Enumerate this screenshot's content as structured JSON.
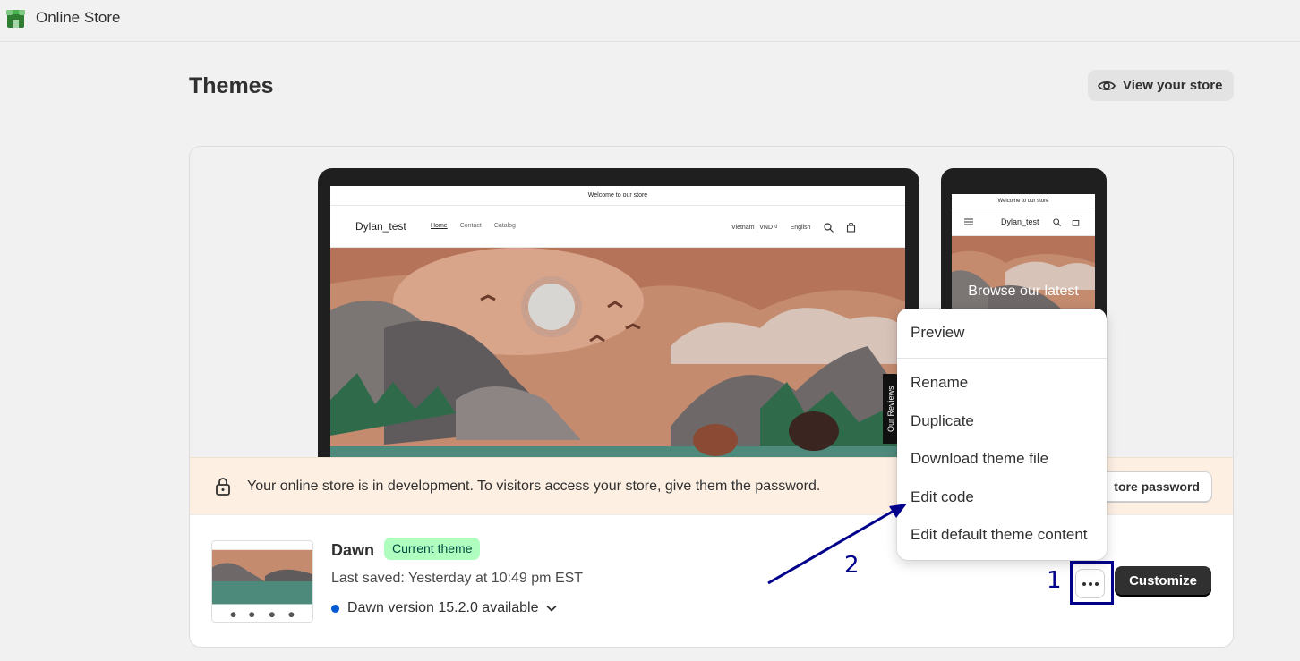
{
  "topbar": {
    "app_title": "Online Store"
  },
  "page": {
    "title": "Themes",
    "view_store_label": "View your store"
  },
  "preview": {
    "desktop": {
      "announcement": "Welcome to our store",
      "store_name": "Dylan_test",
      "nav": [
        "Home",
        "Contact",
        "Catalog"
      ],
      "currency": "Vietnam | VND ₫",
      "language": "English"
    },
    "mobile": {
      "announcement": "Welcome to our store",
      "store_name": "Dylan_test",
      "hero_text": "Browse our latest"
    },
    "reviews_tab": "Our Reviews"
  },
  "banner": {
    "text": "Your online store is in development. To visitors access your store, give them the password.",
    "button_label": "tore password"
  },
  "theme": {
    "name": "Dawn",
    "badge": "Current theme",
    "last_saved": "Last saved: Yesterday at 10:49 pm EST",
    "version": "Dawn version 15.2.0 available",
    "customize_label": "Customize"
  },
  "menu": {
    "items": [
      "Preview",
      "Rename",
      "Duplicate",
      "Download theme file",
      "Edit code",
      "Edit default theme content"
    ]
  },
  "annotations": {
    "step1": "1",
    "step2": "2"
  },
  "colors": {
    "accent_badge": "#affebf",
    "annotation": "#00008b",
    "banner_bg": "#fdf0e3",
    "dot": "#005bd3"
  }
}
